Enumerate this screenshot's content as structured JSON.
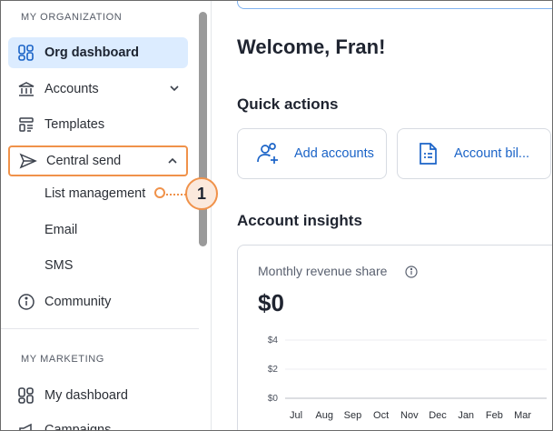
{
  "sidebar": {
    "org_section_label": "MY ORGANIZATION",
    "marketing_section_label": "MY MARKETING",
    "items": {
      "org_dashboard": "Org dashboard",
      "accounts": "Accounts",
      "templates": "Templates",
      "central_send": "Central send",
      "community": "Community",
      "my_dashboard": "My dashboard",
      "campaigns": "Campaigns"
    },
    "central_send_sub": [
      "List management",
      "Email",
      "SMS"
    ]
  },
  "callout": {
    "number": "1"
  },
  "main": {
    "welcome": "Welcome, Fran!",
    "quick_actions_title": "Quick actions",
    "quick_actions": [
      {
        "label": "Add accounts",
        "icon": "add-user-icon"
      },
      {
        "label": "Account bil...",
        "icon": "document-icon"
      }
    ],
    "insights_title": "Account insights",
    "revenue_label": "Monthly revenue share",
    "revenue_value": "$0"
  },
  "colors": {
    "accent": "#1a63c7",
    "active_bg": "#dcecff",
    "callout": "#f0924a"
  },
  "chart_data": {
    "type": "line",
    "title": "Monthly revenue share",
    "categories": [
      "Jul",
      "Aug",
      "Sep",
      "Oct",
      "Nov",
      "Dec",
      "Jan",
      "Feb",
      "Mar"
    ],
    "y_ticks": [
      "$4",
      "$2",
      "$0"
    ],
    "ylim": [
      0,
      4
    ],
    "series": [],
    "grid": true
  }
}
